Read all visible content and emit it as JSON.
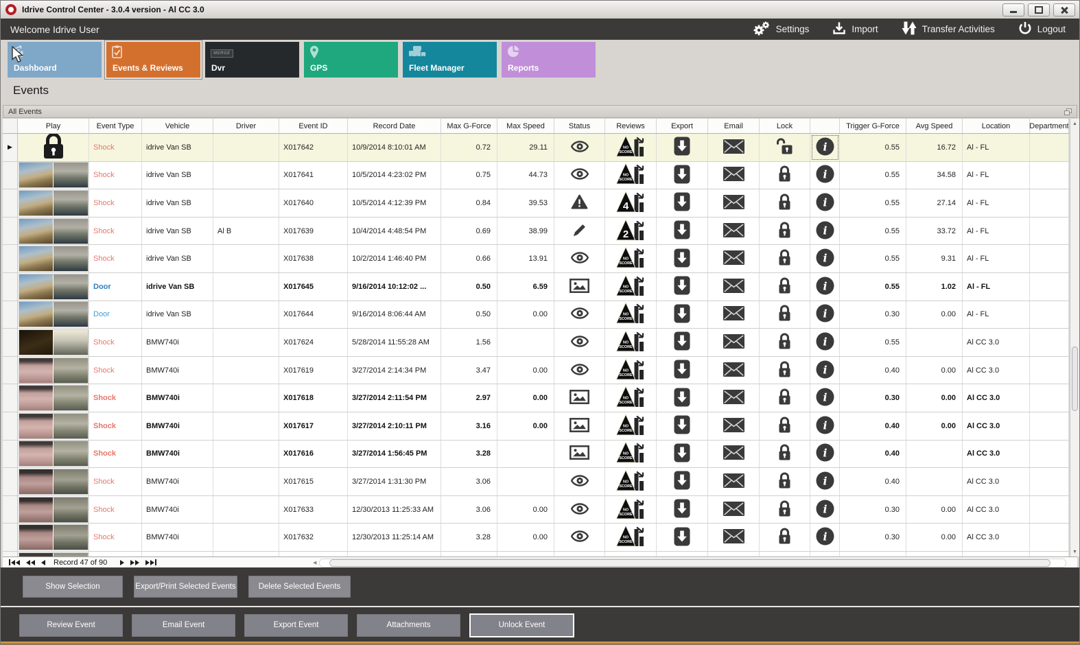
{
  "window": {
    "title": "Idrive Control Center - 3.0.4 version - Al CC 3.0"
  },
  "topbar": {
    "welcome": "Welcome Idrive User",
    "actions": [
      {
        "label": "Settings",
        "icon": "gears-icon"
      },
      {
        "label": "Import",
        "icon": "import-download-icon"
      },
      {
        "label": "Transfer Activities",
        "icon": "transfer-arrows-icon"
      },
      {
        "label": "Logout",
        "icon": "power-icon"
      }
    ]
  },
  "tabs": [
    {
      "label": "Dashboard",
      "color": "#7fa7c7",
      "icon": "dashboard-chart-icon",
      "selected": false
    },
    {
      "label": "Events & Reviews",
      "color": "#d4702e",
      "icon": "clipboard-check-icon",
      "selected": true
    },
    {
      "label": "Dvr",
      "color": "#26292c",
      "icon": "merge-badge-icon",
      "selected": false
    },
    {
      "label": "GPS",
      "color": "#1fa87d",
      "icon": "map-pin-icon",
      "selected": false
    },
    {
      "label": "Fleet Manager",
      "color": "#15879c",
      "icon": "fleet-trucks-icon",
      "selected": false
    },
    {
      "label": "Reports",
      "color": "#c18fd9",
      "icon": "pie-chart-icon",
      "selected": false
    }
  ],
  "page": {
    "title": "Events",
    "group_label": "All Events"
  },
  "table": {
    "columns": [
      "Play",
      "Event Type",
      "Vehicle",
      "Driver",
      "Event ID",
      "Record Date",
      "Max G-Force",
      "Max Speed",
      "Status",
      "Reviews",
      "Export",
      "Email",
      "Lock",
      "",
      "Trigger G-Force",
      "Avg Speed",
      "Location",
      "Department"
    ],
    "row_action_icons": [
      "export-download-icon",
      "email-envelope-icon",
      "info-icon"
    ],
    "rows": [
      {
        "thumb": "lock",
        "event_type": "Shock",
        "vehicle": "idrive Van SB",
        "driver": "",
        "event_id": "X017642",
        "record_date": "10/9/2014 8:10:01 AM",
        "max_g": "0.72",
        "max_speed": "29.11",
        "status_icon": "eye-icon",
        "review_score": "NO SCORE",
        "lock_icon": "unlock-icon",
        "trigger_g": "0.55",
        "avg_speed": "16.72",
        "location": "Al - FL",
        "department": "",
        "bold": false,
        "selected": true
      },
      {
        "thumb": "road",
        "event_type": "Shock",
        "vehicle": "idrive Van SB",
        "driver": "",
        "event_id": "X017641",
        "record_date": "10/5/2014 4:23:02 PM",
        "max_g": "0.75",
        "max_speed": "44.73",
        "status_icon": "eye-icon",
        "review_score": "NO SCORE",
        "lock_icon": "lock-icon",
        "trigger_g": "0.55",
        "avg_speed": "34.58",
        "location": "Al - FL",
        "department": "",
        "bold": false,
        "selected": false
      },
      {
        "thumb": "road",
        "event_type": "Shock",
        "vehicle": "idrive Van SB",
        "driver": "",
        "event_id": "X017640",
        "record_date": "10/5/2014 4:12:39 PM",
        "max_g": "0.84",
        "max_speed": "39.53",
        "status_icon": "warning-icon",
        "review_score": "4",
        "lock_icon": "lock-icon",
        "trigger_g": "0.55",
        "avg_speed": "27.14",
        "location": "Al - FL",
        "department": "",
        "bold": false,
        "selected": false
      },
      {
        "thumb": "road",
        "event_type": "Shock",
        "vehicle": "idrive Van SB",
        "driver": "Al B",
        "event_id": "X017639",
        "record_date": "10/4/2014 4:48:54 PM",
        "max_g": "0.69",
        "max_speed": "38.99",
        "status_icon": "pencil-icon",
        "review_score": "2",
        "lock_icon": "lock-icon",
        "trigger_g": "0.55",
        "avg_speed": "33.72",
        "location": "Al - FL",
        "department": "",
        "bold": false,
        "selected": false
      },
      {
        "thumb": "road",
        "event_type": "Shock",
        "vehicle": "idrive Van SB",
        "driver": "",
        "event_id": "X017638",
        "record_date": "10/2/2014 1:46:40 PM",
        "max_g": "0.66",
        "max_speed": "13.91",
        "status_icon": "eye-icon",
        "review_score": "NO SCORE",
        "lock_icon": "lock-icon",
        "trigger_g": "0.55",
        "avg_speed": "9.31",
        "location": "Al - FL",
        "department": "",
        "bold": false,
        "selected": false
      },
      {
        "thumb": "road",
        "event_type": "Door",
        "vehicle": "idrive Van SB",
        "driver": "",
        "event_id": "X017645",
        "record_date": "9/16/2014 10:12:02 ...",
        "max_g": "0.50",
        "max_speed": "6.59",
        "status_icon": "picture-icon",
        "review_score": "NO SCORE",
        "lock_icon": "lock-icon",
        "trigger_g": "0.55",
        "avg_speed": "1.02",
        "location": "Al - FL",
        "department": "",
        "bold": true,
        "selected": false
      },
      {
        "thumb": "road",
        "event_type": "Door",
        "vehicle": "idrive Van SB",
        "driver": "",
        "event_id": "X017644",
        "record_date": "9/16/2014 8:06:44 AM",
        "max_g": "0.50",
        "max_speed": "0.00",
        "status_icon": "eye-icon",
        "review_score": "NO SCORE",
        "lock_icon": "lock-icon",
        "trigger_g": "0.30",
        "avg_speed": "0.00",
        "location": "Al - FL",
        "department": "",
        "bold": false,
        "selected": false
      },
      {
        "thumb": "dark",
        "event_type": "Shock",
        "vehicle": "BMW740i",
        "driver": "",
        "event_id": "X017624",
        "record_date": "5/28/2014 11:55:28 AM",
        "max_g": "1.56",
        "max_speed": "",
        "status_icon": "eye-icon",
        "review_score": "NO SCORE",
        "lock_icon": "lock-icon",
        "trigger_g": "0.55",
        "avg_speed": "",
        "location": "Al CC 3.0",
        "department": "",
        "bold": false,
        "selected": false
      },
      {
        "thumb": "pink",
        "event_type": "Shock",
        "vehicle": "BMW740i",
        "driver": "",
        "event_id": "X017619",
        "record_date": "3/27/2014 2:14:34 PM",
        "max_g": "3.47",
        "max_speed": "0.00",
        "status_icon": "eye-icon",
        "review_score": "NO SCORE",
        "lock_icon": "lock-icon",
        "trigger_g": "0.40",
        "avg_speed": "0.00",
        "location": "Al CC 3.0",
        "department": "",
        "bold": false,
        "selected": false
      },
      {
        "thumb": "pink",
        "event_type": "Shock",
        "vehicle": "BMW740i",
        "driver": "",
        "event_id": "X017618",
        "record_date": "3/27/2014 2:11:54 PM",
        "max_g": "2.97",
        "max_speed": "0.00",
        "status_icon": "picture-icon",
        "review_score": "NO SCORE",
        "lock_icon": "lock-icon",
        "trigger_g": "0.30",
        "avg_speed": "0.00",
        "location": "Al CC 3.0",
        "department": "",
        "bold": true,
        "selected": false
      },
      {
        "thumb": "pink",
        "event_type": "Shock",
        "vehicle": "BMW740i",
        "driver": "",
        "event_id": "X017617",
        "record_date": "3/27/2014 2:10:11 PM",
        "max_g": "3.16",
        "max_speed": "0.00",
        "status_icon": "picture-icon",
        "review_score": "NO SCORE",
        "lock_icon": "lock-icon",
        "trigger_g": "0.40",
        "avg_speed": "0.00",
        "location": "Al CC 3.0",
        "department": "",
        "bold": true,
        "selected": false
      },
      {
        "thumb": "pink",
        "event_type": "Shock",
        "vehicle": "BMW740i",
        "driver": "",
        "event_id": "X017616",
        "record_date": "3/27/2014 1:56:45 PM",
        "max_g": "3.28",
        "max_speed": "",
        "status_icon": "picture-icon",
        "review_score": "NO SCORE",
        "lock_icon": "lock-icon",
        "trigger_g": "0.40",
        "avg_speed": "",
        "location": "Al CC 3.0",
        "department": "",
        "bold": true,
        "selected": false
      },
      {
        "thumb": "pinkdark",
        "event_type": "Shock",
        "vehicle": "BMW740i",
        "driver": "",
        "event_id": "X017615",
        "record_date": "3/27/2014 1:31:30 PM",
        "max_g": "3.06",
        "max_speed": "",
        "status_icon": "eye-icon",
        "review_score": "NO SCORE",
        "lock_icon": "lock-icon",
        "trigger_g": "0.40",
        "avg_speed": "",
        "location": "Al CC 3.0",
        "department": "",
        "bold": false,
        "selected": false
      },
      {
        "thumb": "pinkdark",
        "event_type": "Shock",
        "vehicle": "BMW740i",
        "driver": "",
        "event_id": "X017633",
        "record_date": "12/30/2013 11:25:33 AM",
        "max_g": "3.06",
        "max_speed": "0.00",
        "status_icon": "eye-icon",
        "review_score": "NO SCORE",
        "lock_icon": "lock-icon",
        "trigger_g": "0.30",
        "avg_speed": "0.00",
        "location": "Al CC 3.0",
        "department": "",
        "bold": false,
        "selected": false
      },
      {
        "thumb": "pinkdark",
        "event_type": "Shock",
        "vehicle": "BMW740i",
        "driver": "",
        "event_id": "X017632",
        "record_date": "12/30/2013 11:25:14 AM",
        "max_g": "3.28",
        "max_speed": "0.00",
        "status_icon": "eye-icon",
        "review_score": "NO SCORE",
        "lock_icon": "lock-icon",
        "trigger_g": "0.30",
        "avg_speed": "0.00",
        "location": "Al CC 3.0",
        "department": "",
        "bold": false,
        "selected": false
      },
      {
        "thumb": "pink",
        "partial": true,
        "event_type": "",
        "vehicle": "",
        "driver": "",
        "event_id": "",
        "record_date": "",
        "max_g": "",
        "max_speed": "",
        "status_icon": "",
        "review_score": "",
        "lock_icon": "",
        "trigger_g": "",
        "avg_speed": "",
        "location": "",
        "department": "",
        "bold": false,
        "selected": false
      }
    ]
  },
  "pager": {
    "record_text": "Record 47 of 90",
    "icons": [
      "first-page-icon",
      "fast-prev-icon",
      "prev-page-icon",
      "next-page-icon",
      "fast-next-icon",
      "last-page-icon"
    ]
  },
  "selection_actions": [
    "Show Selection",
    "Export/Print Selected Events",
    "Delete Selected  Events"
  ],
  "event_actions": [
    "Review Event",
    "Email Event",
    "Export Event",
    "Attachments",
    "Unlock Event"
  ],
  "colors": {
    "accent_orange": "#d4702e",
    "topbar_dark": "#3b3a38",
    "shock_text": "#e8766b",
    "door_text": "#3d9ad4",
    "selected_row": "#f6f6df",
    "bottom_strip": "#a96a1e"
  }
}
